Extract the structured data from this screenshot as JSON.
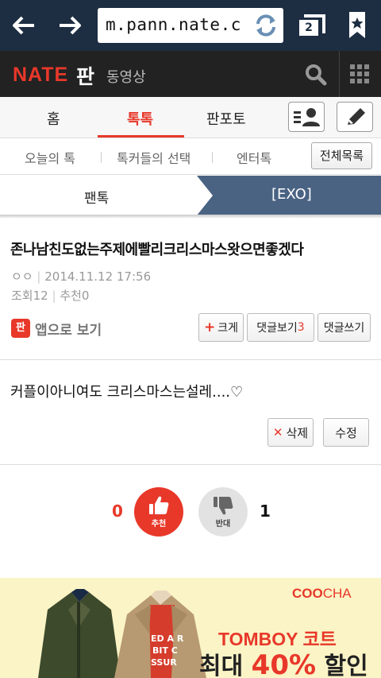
{
  "browser": {
    "url": "m.pann.nate.c",
    "tab_count": "2"
  },
  "header": {
    "logo": "NATE",
    "pan": "판",
    "video": "동영상"
  },
  "main_tabs": {
    "home": "홈",
    "toktok": "톡톡",
    "panpoto": "판포토"
  },
  "sub_nav": {
    "today": "오늘의 톡",
    "choice": "톡커들의 선택",
    "enter": "엔터톡",
    "all_list": "전체목록"
  },
  "breadcrumb": {
    "left": "팬톡",
    "right": "[EXO]"
  },
  "post": {
    "title": "존나남친도없는주제에빨리크리스마스왓으면좋겠다",
    "author": "ㅇㅇ",
    "date": "2014.11.12 17:56",
    "views": "조회12",
    "recommends": "추천0",
    "app_view": "앱으로 보기",
    "app_icon_text": "판",
    "btn_size": "크게",
    "btn_comments": "댓글보기",
    "comment_count": "3",
    "btn_write": "댓글쓰기",
    "content": "커플이아니여도 크리스마스는설레....♡",
    "btn_delete": "삭제",
    "btn_edit": "수정"
  },
  "votes": {
    "up_count": "0",
    "up_label": "추천",
    "down_count": "1",
    "down_label": "반대"
  },
  "ad": {
    "brand_a": "COO",
    "brand_b": "CHA",
    "line1": "TOMBOY 코트",
    "line2_a": "최대",
    "line2_b": "40%",
    "line2_c": "할인"
  },
  "colors": {
    "accent": "#e8382a",
    "browser_bar": "#1d2d42",
    "header_bg": "#222222",
    "crumb_active": "#4a6383"
  }
}
